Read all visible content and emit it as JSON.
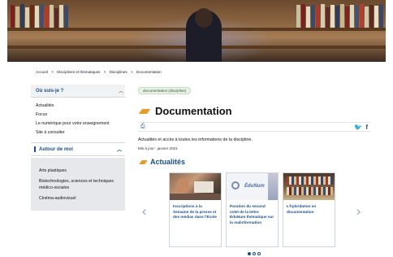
{
  "breadcrumb": [
    "Accueil",
    ">",
    "Disciplines et thématiques",
    ">",
    "Disciplines",
    ">",
    "Documentation"
  ],
  "sidebar": {
    "where_title": "Où suis-je ?",
    "links": [
      "Actualités",
      "Focus",
      "Le numérique pour votre enseignement",
      "Site à consulter"
    ],
    "around_title": "Autour de moi",
    "around_links": [
      "Arts plastiques",
      "Biotechnologies, sciences et techniques médico-sociales",
      "Cinéma-audiovisuel"
    ]
  },
  "main": {
    "tag": "documentation (discipline)",
    "title": "Documentation",
    "intro": "Actualités et accès à toutes les informations de la discipline.",
    "updated": "Mis à jour : janvier 2021",
    "section_title": "Actualités"
  },
  "carousel": {
    "cards": [
      {
        "text": "Inscriptions à la Semaine de la presse et des médias dans l'École",
        "image": "classroom-photo"
      },
      {
        "text": "Parution du second volet de la lettre ÉduNum thématique sur la malinformation",
        "image": "edunum-logo",
        "logo_text": "ÉduNum"
      },
      {
        "text": "L'hybridation en documentation",
        "image": "library-photo"
      }
    ],
    "page_count": 3,
    "active_page": 1
  },
  "colors": {
    "accent": "#e79a2a",
    "link": "#1a4f8a"
  }
}
